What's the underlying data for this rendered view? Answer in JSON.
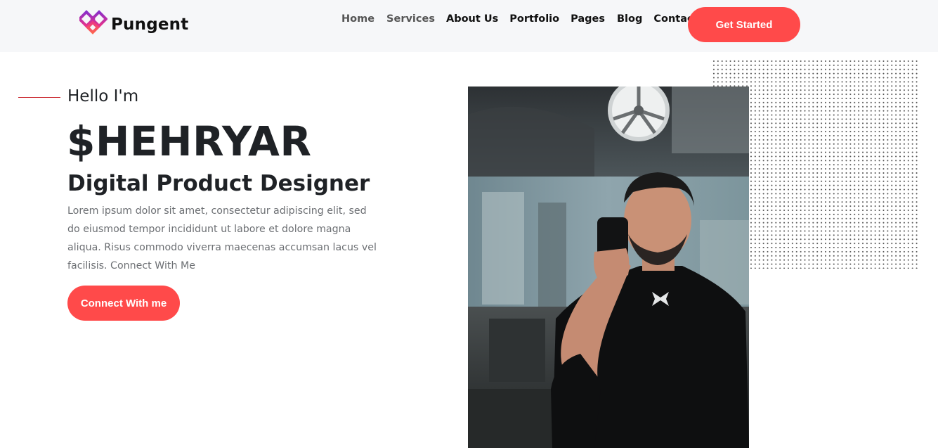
{
  "brand": {
    "name": "Pungent",
    "logo_icon": "diamond-logo-icon",
    "colors": {
      "purple": "#8b2fc9",
      "pink": "#e8328a",
      "red": "#ff4a4a"
    }
  },
  "nav": {
    "items": [
      {
        "label": "Home",
        "active": false
      },
      {
        "label": "Services",
        "active": false
      },
      {
        "label": "About Us",
        "active": false
      },
      {
        "label": "Portfolio",
        "active": false
      },
      {
        "label": "Pages",
        "active": false
      },
      {
        "label": "Blog",
        "active": false
      },
      {
        "label": "Contact Us",
        "active": false
      }
    ],
    "cta_label": "Get Started"
  },
  "hero": {
    "greeting": "Hello I'm",
    "name": "$HEHRYAR",
    "role": "Digital Product Designer",
    "description": "Lorem ipsum dolor sit amet, consectetur adipiscing elit, sed do eiusmod tempor incididunt ut labore et dolore magna aliqua. Risus commodo viverra maecenas accumsan lacus vel facilisis. Connect With Me",
    "button_label": "Connect With me",
    "accent_color": "#ff4a4a",
    "line_color": "#c81d25"
  },
  "photo": {
    "subject": "man taking mirror selfie in gym"
  }
}
